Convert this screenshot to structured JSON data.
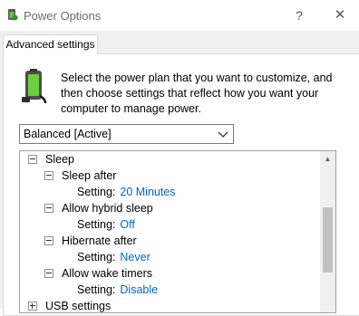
{
  "window": {
    "title": "Power Options",
    "help_label": "?",
    "close_label": "✕"
  },
  "tab": {
    "label": "Advanced settings"
  },
  "instructions": "Select the power plan that you want to customize, and then choose settings that reflect how you want your computer to manage power.",
  "plan_dropdown": {
    "selected": "Balanced [Active]"
  },
  "tree": {
    "sleep": {
      "label": "Sleep",
      "sleep_after": {
        "label": "Sleep after",
        "setting_label": "Setting:",
        "value": "20 Minutes"
      },
      "hybrid_sleep": {
        "label": "Allow hybrid sleep",
        "setting_label": "Setting:",
        "value": "Off"
      },
      "hibernate_after": {
        "label": "Hibernate after",
        "setting_label": "Setting:",
        "value": "Never"
      },
      "wake_timers": {
        "label": "Allow wake timers",
        "setting_label": "Setting:",
        "value": "Disable"
      }
    },
    "usb": {
      "label": "USB settings"
    }
  },
  "colors": {
    "link_value": "#0066cc",
    "window_bg": "#f0f0f0"
  }
}
